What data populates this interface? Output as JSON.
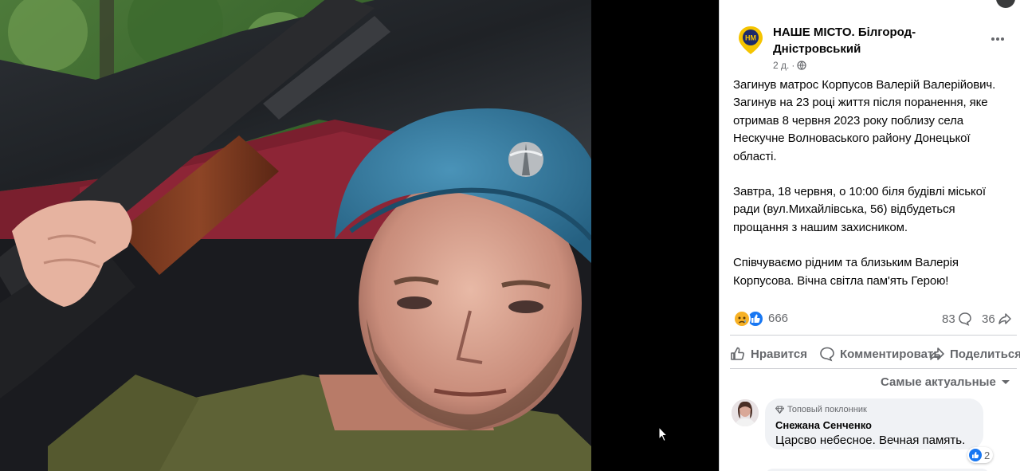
{
  "page": {
    "name": "НАШЕ МІСТО. Білгород-Дністровський",
    "avatar_text": "НМ",
    "time": "2 д.",
    "brand_color": "#f5c400"
  },
  "post": {
    "paragraphs": [
      "Загинув матрос Корпусов Валерій Валерійович. Загинув на 23 році життя після поранення, яке отримав 8 червня 2023 року поблизу села Нескучне Волноваського району Донецької області.",
      "Завтра, 18 червня, о 10:00 біля будівлі міської ради (вул.Михайлівська, 56) відбудеться прощання з нашим захисником.",
      "Співчуваємо рідним та близьким Валерія Корпусова. Вічна світла пам'ять Герою!"
    ]
  },
  "stats": {
    "reactions": "666",
    "comments": "83",
    "shares": "36",
    "reaction_icons": [
      "sad-icon",
      "like-icon"
    ]
  },
  "actions": {
    "like": "Нравится",
    "comment": "Комментировать",
    "share": "Поделиться"
  },
  "comments_sort": "Самые актуальные",
  "comment": {
    "badge": "Топовый поклонник",
    "author": "Снежана Сенченко",
    "text": "Царсво небесное. Вечная память.",
    "likes": "2"
  },
  "colors": {
    "like_blue": "#1877f2",
    "secondary_text": "#65676b",
    "beret_blue": "#2f7fa8"
  }
}
